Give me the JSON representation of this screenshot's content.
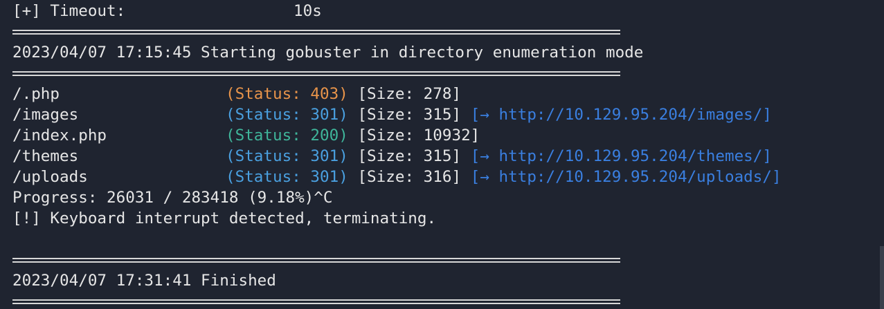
{
  "header": {
    "timeout_label": "[+] Timeout:",
    "timeout_value": "10s"
  },
  "start_line": "2023/04/07 17:15:45 Starting gobuster in directory enumeration mode",
  "results": [
    {
      "path": "/.php",
      "status": "(Status: 403)",
      "code": "403",
      "size": "[Size: 278]",
      "redirect": ""
    },
    {
      "path": "/images",
      "status": "(Status: 301)",
      "code": "301",
      "size": "[Size: 315]",
      "redirect": "[→ http://10.129.95.204/images/]"
    },
    {
      "path": "/index.php",
      "status": "(Status: 200)",
      "code": "200",
      "size": "[Size: 10932]",
      "redirect": ""
    },
    {
      "path": "/themes",
      "status": "(Status: 301)",
      "code": "301",
      "size": "[Size: 315]",
      "redirect": "[→ http://10.129.95.204/themes/]"
    },
    {
      "path": "/uploads",
      "status": "(Status: 301)",
      "code": "301",
      "size": "[Size: 316]",
      "redirect": "[→ http://10.129.95.204/uploads/]"
    }
  ],
  "progress_line": "Progress: 26031 / 283418 (9.18%)^C",
  "interrupt_line": "[!] Keyboard interrupt detected, terminating.",
  "finished_line": "2023/04/07 17:31:41 Finished",
  "colors": {
    "background": "#1f2430",
    "status_403": "#e8944a",
    "status_301": "#4aa0e0",
    "status_200": "#3fb59a",
    "redirect": "#3a7fe0"
  }
}
